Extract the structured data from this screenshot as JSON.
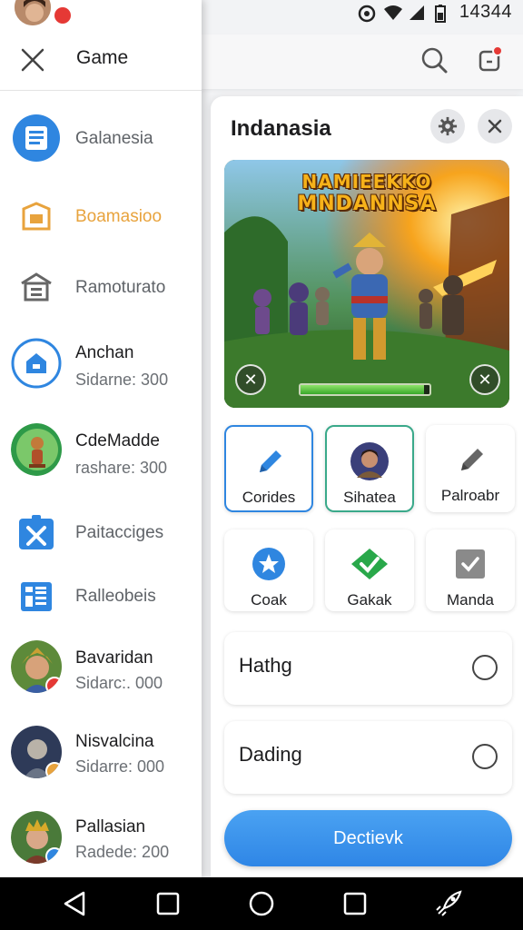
{
  "status_bar": {
    "time": "14344",
    "icons": [
      "settings-circle-icon",
      "wifi-icon",
      "signal-icon",
      "battery-icon"
    ]
  },
  "drawer": {
    "title": "Game",
    "items": [
      {
        "label": "Galanesia",
        "icon": "document-icon",
        "selected": true
      },
      {
        "label": "Boamasioo",
        "icon": "store-icon",
        "highlight": true
      },
      {
        "label": "Ramoturato",
        "icon": "building-icon"
      },
      {
        "label": "Anchan",
        "sub": "Sidarne: 300",
        "icon": "home-icon"
      },
      {
        "label": "CdeMadde",
        "sub": "rashare: 300",
        "icon": "game-avatar"
      },
      {
        "label": "Paitacciges",
        "icon": "crossed-tools-icon"
      },
      {
        "label": "Ralleobeis",
        "icon": "building-grid-icon"
      },
      {
        "label": "Bavaridan",
        "sub": "Sidarc:. 000",
        "icon": "hero-avatar"
      },
      {
        "label": "Nisvalcina",
        "sub": "Sidarre: 000",
        "icon": "warrior-avatar"
      },
      {
        "label": "Pallasian",
        "sub": "Radede: 200",
        "icon": "queen-avatar"
      }
    ]
  },
  "panel": {
    "title": "Indanasia",
    "banner": {
      "title_line1": "NAMIEEKKO",
      "title_line2": "MNDANNSA",
      "progress": 0.96
    },
    "tiles": [
      {
        "label": "Corides",
        "icon": "pencil-icon",
        "color": "#2f86e0"
      },
      {
        "label": "Sihatea",
        "icon": "character-portrait"
      },
      {
        "label": "Palroabr",
        "icon": "pencil-icon"
      },
      {
        "label": "Coak",
        "icon": "star-badge-icon",
        "color": "#2f86e0"
      },
      {
        "label": "Gakak",
        "icon": "check-badge-icon",
        "color": "#29a84a"
      },
      {
        "label": "Manda",
        "icon": "checkbox-icon"
      }
    ],
    "options": [
      {
        "label": "Hathg"
      },
      {
        "label": "Dading"
      }
    ],
    "primary_button": "Dectievk"
  },
  "colors": {
    "accent": "#2f86e0",
    "orange": "#e8a33d",
    "notification": "#e53935"
  }
}
